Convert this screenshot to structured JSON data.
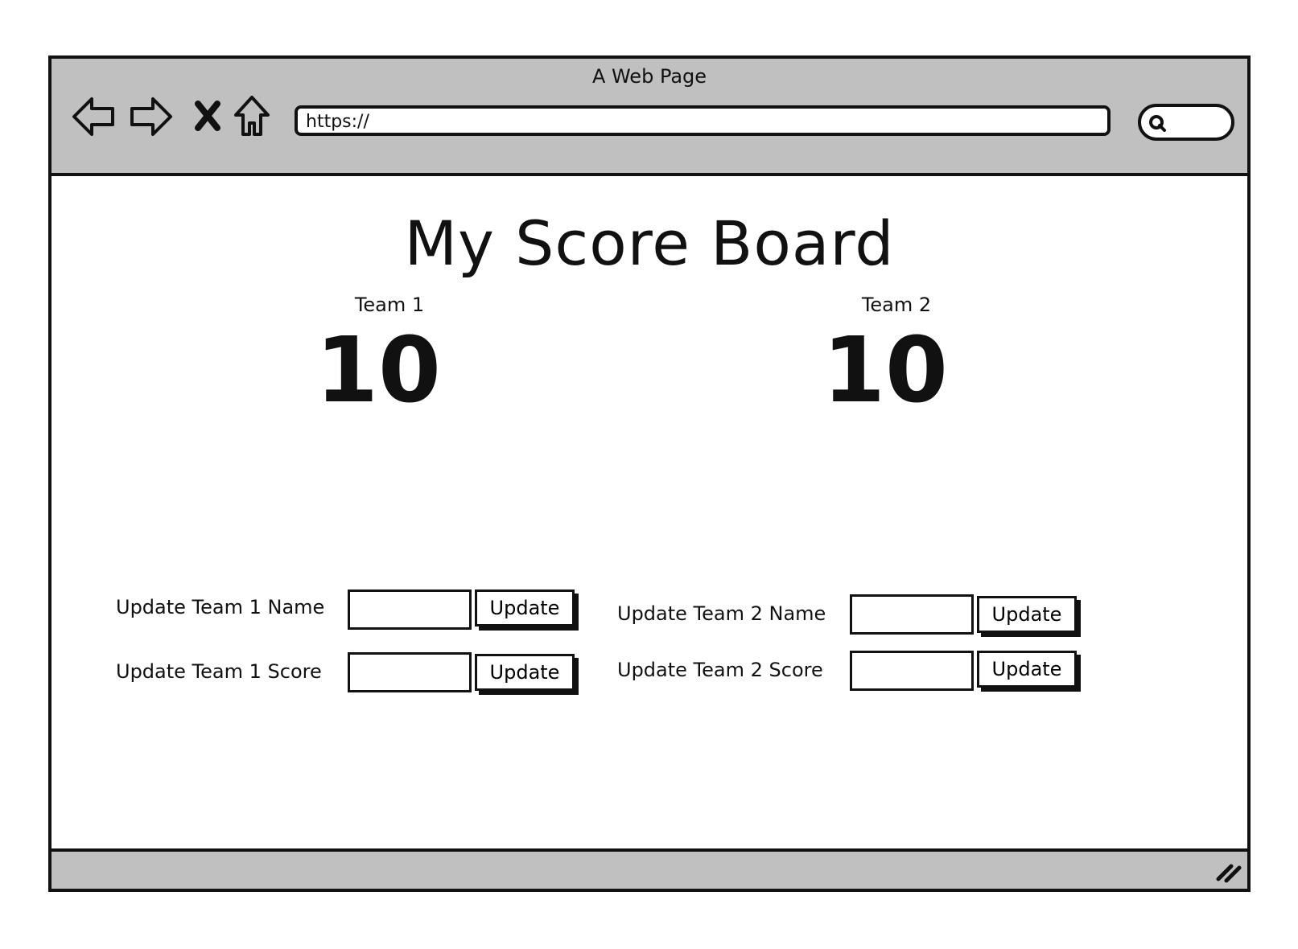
{
  "window": {
    "title": "A Web Page",
    "url": "https://"
  },
  "icons": {
    "back": "arrow-left-icon",
    "forward": "arrow-right-icon",
    "stop": "close-icon",
    "home": "home-icon",
    "search": "search-icon",
    "resize": "resize-grip-icon"
  },
  "page": {
    "title": "My Score Board",
    "team1": {
      "label": "Team 1",
      "score": "10"
    },
    "team2": {
      "label": "Team 2",
      "score": "10"
    }
  },
  "forms": {
    "team1_name_label": "Update Team 1 Name",
    "team1_score_label": "Update Team 1 Score",
    "team2_name_label": "Update Team 2 Name",
    "team2_score_label": "Update Team 2 Score",
    "update_label": "Update"
  },
  "colors": {
    "chrome": "#c0c0c0",
    "ink": "#111111",
    "background": "#ffffff"
  }
}
